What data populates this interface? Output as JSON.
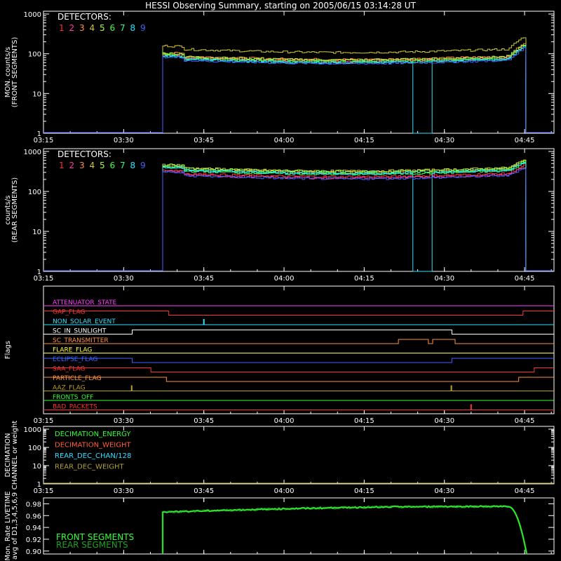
{
  "title": "HESSI Observing Summary, starting on 2005/06/15 03:14:28 UT",
  "x_tick_labels": [
    "03:15",
    "03:30",
    "03:45",
    "04:00",
    "04:15",
    "04:30",
    "04:45"
  ],
  "x_ticks": [
    0,
    15,
    30,
    45,
    60,
    75,
    90
  ],
  "chart_data": [
    {
      "type": "line",
      "panel": "front",
      "ylabel_lines": [
        "MON. counts/s",
        "(FRONT SEGMENTS)"
      ],
      "yscale": "log",
      "ylim": [
        1,
        1000
      ],
      "ytick_labels": [
        "1",
        "10",
        "100",
        "1000"
      ],
      "xlim_minutes_from_0315": [
        0,
        95.5
      ],
      "legend_title": "DETECTORS:",
      "legend": [
        "1",
        "2",
        "3",
        "4",
        "5",
        "6",
        "7",
        "8",
        "9"
      ],
      "data_start": 22.3,
      "data_end": 90.2,
      "series": [
        {
          "name": "1",
          "color": "#ff3030",
          "base": 75
        },
        {
          "name": "2",
          "color": "#ff3aa0",
          "base": 72
        },
        {
          "name": "3",
          "color": "#ff9040",
          "base": 80
        },
        {
          "name": "4",
          "color": "#d0c830",
          "base": 120
        },
        {
          "name": "5",
          "color": "#a0ff40",
          "base": 78
        },
        {
          "name": "6",
          "color": "#40ff40",
          "base": 70
        },
        {
          "name": "7",
          "color": "#20ff9a",
          "base": 68
        },
        {
          "name": "8",
          "color": "#30e0ff",
          "base": 66
        },
        {
          "name": "9",
          "color": "#4060ff",
          "base": 63
        }
      ],
      "dropout": {
        "series": "8",
        "from": 68.7,
        "to": 72.3
      }
    },
    {
      "type": "line",
      "panel": "rear",
      "ylabel_lines": [
        "counts/s",
        "(REAR SEGMENTS)"
      ],
      "yscale": "log",
      "ylim": [
        1,
        1000
      ],
      "ytick_labels": [
        "1",
        "10",
        "100",
        "1000"
      ],
      "legend_title": "DETECTORS:",
      "legend": [
        "1",
        "2",
        "3",
        "4",
        "5",
        "6",
        "7",
        "8",
        "9"
      ],
      "data_start": 22.3,
      "data_end": 90.2,
      "series": [
        {
          "name": "1",
          "color": "#ff3030",
          "base": 260
        },
        {
          "name": "2",
          "color": "#ff3aa0",
          "base": 240
        },
        {
          "name": "3",
          "color": "#ff9040",
          "base": 330
        },
        {
          "name": "4",
          "color": "#d0c830",
          "base": 360
        },
        {
          "name": "5",
          "color": "#a0ff40",
          "base": 350
        },
        {
          "name": "6",
          "color": "#40ff40",
          "base": 300
        },
        {
          "name": "7",
          "color": "#20ff9a",
          "base": 320
        },
        {
          "name": "8",
          "color": "#30e0ff",
          "base": 310
        },
        {
          "name": "9",
          "color": "#4060ff",
          "base": 230
        }
      ],
      "dropout": {
        "series": "8",
        "from": 68.7,
        "to": 72.3
      }
    },
    {
      "type": "line",
      "panel": "flags",
      "ylabel_lines": [
        "Flags"
      ],
      "flags": [
        {
          "label": "ATTENUATOR_STATE",
          "color": "#ff40ff",
          "level": 0,
          "high": []
        },
        {
          "label": "GAP_FLAG",
          "color": "#ff3030",
          "level": 1,
          "high": [
            [
              0,
              23.4
            ],
            [
              89.6,
              95.5
            ]
          ]
        },
        {
          "label": "NON_SOLAR_EVENT",
          "color": "#30e0ff",
          "level": 0,
          "high": [],
          "spikes": [
            30.0
          ]
        },
        {
          "label": "SC_IN_SUNLIGHT",
          "color": "#ffffff",
          "level": 0,
          "high": [
            [
              16.5,
              76.3
            ]
          ]
        },
        {
          "label": "SC_TRANSMITTER",
          "color": "#ff9040",
          "level": 0,
          "high": [
            [
              66.4,
              72.0
            ],
            [
              72.8,
              76.9
            ]
          ]
        },
        {
          "label": "FLARE_FLAG",
          "color": "#ffff40",
          "level": 0,
          "high": []
        },
        {
          "label": "ECLIPSE_FLAG",
          "color": "#4060ff",
          "level": 1,
          "high": [
            [
              0,
              16.5
            ],
            [
              76.3,
              95.5
            ]
          ]
        },
        {
          "label": "SAA_FLAG",
          "color": "#ff3030",
          "level": 1,
          "high": [
            [
              0,
              20.1
            ],
            [
              91.7,
              95.5
            ]
          ]
        },
        {
          "label": "PARTICLE_FLAG",
          "color": "#ff9040",
          "level": 1,
          "high": [
            [
              0,
              23.0
            ],
            [
              88.8,
              95.5
            ]
          ]
        },
        {
          "label": "AAZ_FLAG",
          "color": "#c0a020",
          "level": 0,
          "high": [],
          "spikes": [
            16.5,
            76.3
          ]
        },
        {
          "label": "FRONTS_OFF",
          "color": "#30ff30",
          "level": 0,
          "high": []
        },
        {
          "label": "BAD_PACKETS",
          "color": "#ff3030",
          "level": 0,
          "high": [],
          "spikes": [
            80.0
          ]
        }
      ]
    },
    {
      "type": "line",
      "panel": "decimation",
      "ylabel_lines": [
        "DECIMATION",
        "CHANNEL or weight"
      ],
      "yscale": "log",
      "ylim": [
        1,
        1000
      ],
      "ytick_labels": [
        "1",
        "10",
        "100",
        "1000"
      ],
      "legend": [
        {
          "label": "DECIMATION_ENERGY",
          "color": "#30ff30"
        },
        {
          "label": "DECIMATION_WEIGHT",
          "color": "#ff6030"
        },
        {
          "label": "REAR_DEC_CHAN/128",
          "color": "#30e0ff"
        },
        {
          "label": "REAR_DEC_WEIGHT",
          "color": "#b0a030"
        }
      ]
    },
    {
      "type": "line",
      "panel": "livetime",
      "ylabel_lines": [
        "Mon. Rate LIVETIME",
        "avg of D1,3,4,5,6,9"
      ],
      "ylim": [
        0.895,
        0.99
      ],
      "ytick_labels": [
        "0.90",
        "0.92",
        "0.94",
        "0.96",
        "0.98"
      ],
      "yticks": [
        0.9,
        0.92,
        0.94,
        0.96,
        0.98
      ],
      "legend": [
        {
          "label": "FRONT SEGMENTS",
          "color": "#30ff30"
        },
        {
          "label": "REAR SEGMENTS",
          "color": "#20a020"
        }
      ],
      "data_start": 22.3,
      "data_end": 90.5,
      "values_at": {
        "start": 0.965,
        "mid": 0.97,
        "late": 0.975
      }
    }
  ]
}
